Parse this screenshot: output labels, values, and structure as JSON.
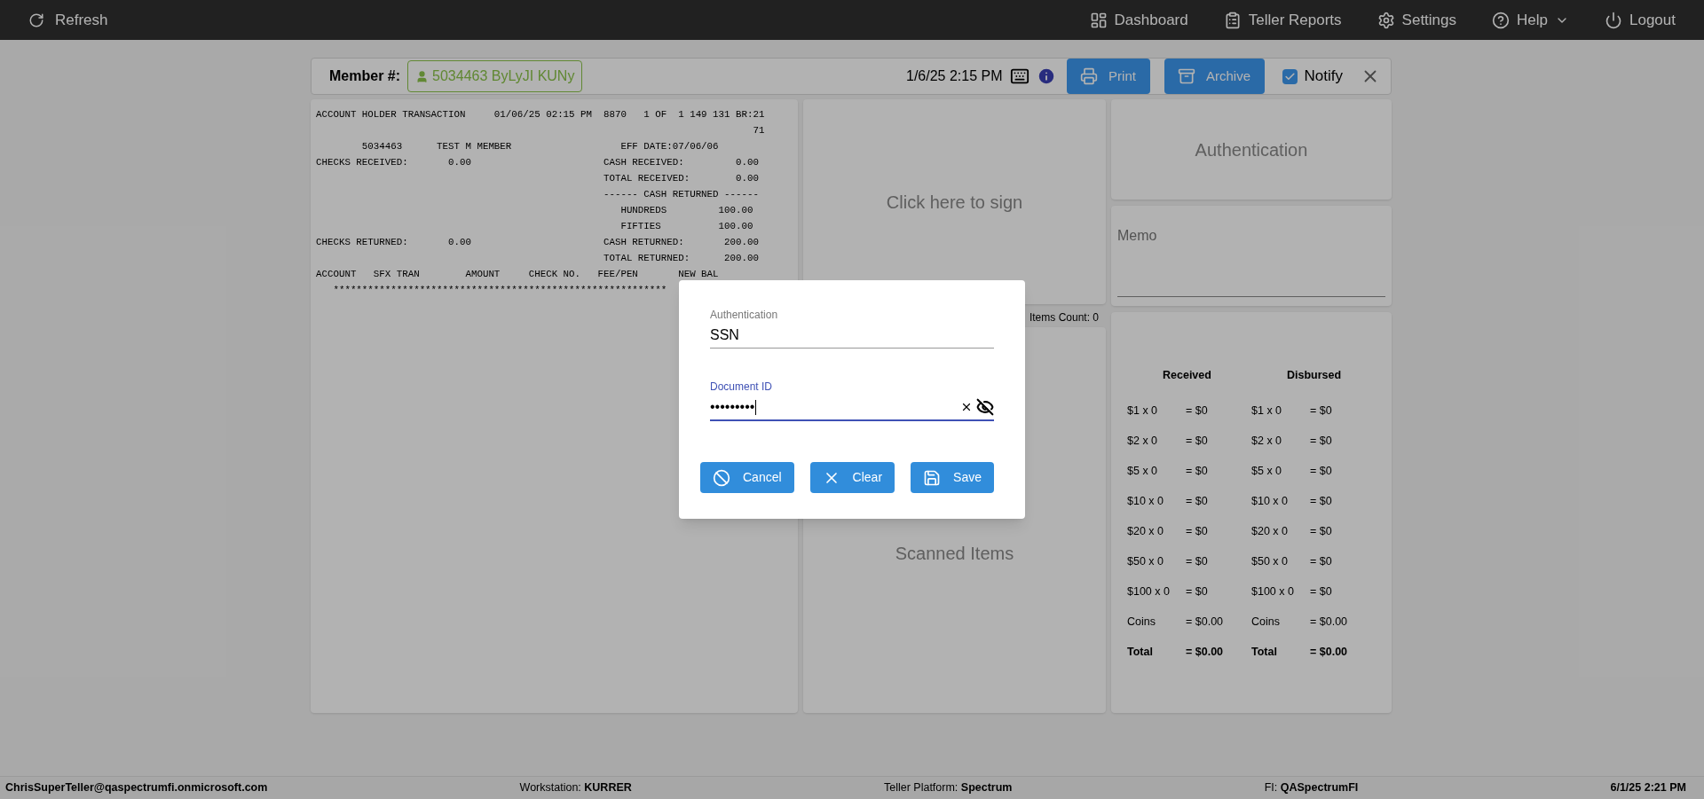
{
  "top_bar": {
    "refresh": "Refresh",
    "nav": [
      {
        "kind": "dashboard",
        "label": "Dashboard",
        "has_menu": false
      },
      {
        "kind": "reports",
        "label": "Teller Reports",
        "has_menu": false
      },
      {
        "kind": "settings",
        "label": "Settings",
        "has_menu": false
      },
      {
        "kind": "help",
        "label": "Help",
        "has_menu": true
      },
      {
        "kind": "logout",
        "label": "Logout",
        "has_menu": false
      }
    ]
  },
  "header": {
    "member_label": "Member #:",
    "member": "5034463 ByLyJI KUNy",
    "datetime": "1/6/25 2:15 PM",
    "print": "Print",
    "archive": "Archive",
    "notify": {
      "label": "Notify",
      "checked": true
    }
  },
  "receipt": {
    "lines": [
      "ACCOUNT HOLDER TRANSACTION     01/06/25 02:15 PM  8870   1 OF  1 149 131 BR:21",
      "                                                                            71",
      "        5034463      TEST M MEMBER                   EFF DATE:07/06/06",
      "CHECKS RECEIVED:       0.00                       CASH RECEIVED:         0.00",
      "                                                  TOTAL RECEIVED:        0.00",
      "                                                  ------ CASH RETURNED ------",
      "                                                     HUNDREDS         100.00",
      "                                                     FIFTIES          100.00",
      "CHECKS RETURNED:       0.00                       CASH RETURNED:       200.00",
      "                                                  TOTAL RETURNED:      200.00",
      "ACCOUNT   SFX TRAN        AMOUNT     CHECK NO.   FEE/PEN       NEW BAL",
      "   **********************************************************"
    ]
  },
  "signature": {
    "prompt": "Click here to sign"
  },
  "scanned": {
    "count": "Items Count: 0",
    "title": "Scanned Items"
  },
  "authentication": {
    "title": "Authentication"
  },
  "memo": {
    "label": "Memo"
  },
  "cash": {
    "columns": [
      {
        "title": "Received",
        "rows": [
          {
            "kind": "line",
            "label": "$1 x 0",
            "value": "= $0"
          },
          {
            "kind": "line",
            "label": "$2 x 0",
            "value": "= $0"
          },
          {
            "kind": "line",
            "label": "$5 x 0",
            "value": "= $0"
          },
          {
            "kind": "line",
            "label": "$10 x 0",
            "value": "= $0"
          },
          {
            "kind": "line",
            "label": "$20 x 0",
            "value": "= $0"
          },
          {
            "kind": "line",
            "label": "$50 x 0",
            "value": "= $0"
          },
          {
            "kind": "line",
            "label": "$100 x 0",
            "value": "= $0"
          },
          {
            "kind": "line",
            "label": "Coins",
            "value": "= $0.00"
          },
          {
            "kind": "total",
            "label": "Total",
            "value": "= $0.00"
          }
        ]
      },
      {
        "title": "Disbursed",
        "rows": [
          {
            "kind": "line",
            "label": "$1 x 0",
            "value": "= $0"
          },
          {
            "kind": "line",
            "label": "$2 x 0",
            "value": "= $0"
          },
          {
            "kind": "line",
            "label": "$5 x 0",
            "value": "= $0"
          },
          {
            "kind": "line",
            "label": "$10 x 0",
            "value": "= $0"
          },
          {
            "kind": "line",
            "label": "$20 x 0",
            "value": "= $0"
          },
          {
            "kind": "line",
            "label": "$50 x 0",
            "value": "= $0"
          },
          {
            "kind": "line",
            "label": "$100 x 0",
            "value": "= $0"
          },
          {
            "kind": "line",
            "label": "Coins",
            "value": "= $0.00"
          },
          {
            "kind": "total",
            "label": "Total",
            "value": "= $0.00"
          }
        ]
      }
    ]
  },
  "dialog": {
    "fields": [
      {
        "label": "Authentication",
        "value": "SSN",
        "focused": false,
        "masked": false
      },
      {
        "label": "Document ID",
        "value": "•••••••••",
        "focused": true,
        "masked": true
      }
    ],
    "buttons": [
      {
        "kind": "cancel",
        "label": "Cancel"
      },
      {
        "kind": "clear",
        "label": "Clear"
      },
      {
        "kind": "save",
        "label": "Save"
      }
    ]
  },
  "status_bar": {
    "user": "ChrisSuperTeller@qaspectrumfi.onmicrosoft.com",
    "items": [
      {
        "label": "Workstation:",
        "value": "KURRER"
      },
      {
        "label": "Teller Platform:",
        "value": "Spectrum"
      },
      {
        "label": "FI:",
        "value": "QASpectrumFI"
      }
    ],
    "datetime": "6/1/25 2:21 PM"
  }
}
